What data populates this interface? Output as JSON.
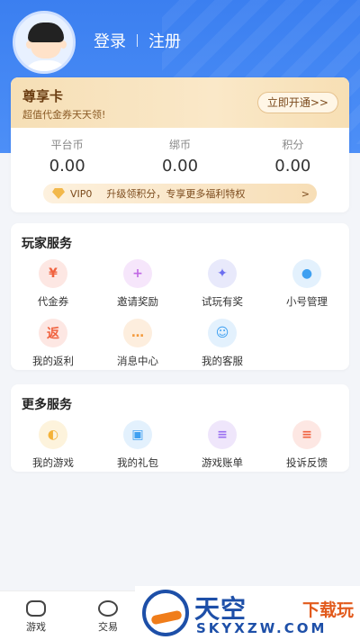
{
  "header": {
    "login": "登录",
    "register": "注册"
  },
  "vip": {
    "title": "尊享卡",
    "subtitle": "超值代金券天天领!",
    "button": "立即开通>>",
    "stats": [
      {
        "label": "平台币",
        "value": "0.00"
      },
      {
        "label": "绑币",
        "value": "0.00"
      },
      {
        "label": "积分",
        "value": "0.00"
      }
    ],
    "level": "VIP0",
    "level_tip": "升级领积分，专享更多福利特权",
    "arrow": ">"
  },
  "player_services": {
    "title": "玩家服务",
    "items": [
      {
        "label": "代金券",
        "icon": "voucher-icon",
        "char": "¥",
        "bg": "#fde7e3",
        "fg": "#f0623f"
      },
      {
        "label": "邀请奖励",
        "icon": "invite-icon",
        "char": "+",
        "bg": "#f6e6fb",
        "fg": "#c169e4"
      },
      {
        "label": "试玩有奖",
        "icon": "gamepad-icon",
        "char": "✦",
        "bg": "#e8e9fb",
        "fg": "#6c6ff0"
      },
      {
        "label": "小号管理",
        "icon": "account-icon",
        "char": "●",
        "bg": "#e3f1fd",
        "fg": "#3fa0f1"
      },
      {
        "label": "我的返利",
        "icon": "rebate-icon",
        "char": "返",
        "bg": "#fde7e3",
        "fg": "#f0623f"
      },
      {
        "label": "消息中心",
        "icon": "message-icon",
        "char": "…",
        "bg": "#fdeede",
        "fg": "#f39a3c"
      },
      {
        "label": "我的客服",
        "icon": "service-icon",
        "char": "☺",
        "bg": "#e3f1fd",
        "fg": "#3fa0f1"
      }
    ]
  },
  "more_services": {
    "title": "更多服务",
    "items": [
      {
        "label": "我的游戏",
        "icon": "game-icon",
        "char": "◐",
        "bg": "#fdf3dc",
        "fg": "#f4b237"
      },
      {
        "label": "我的礼包",
        "icon": "gift-icon",
        "char": "▣",
        "bg": "#e3f1fd",
        "fg": "#3fa0f1"
      },
      {
        "label": "游戏账单",
        "icon": "bill-icon",
        "char": "≡",
        "bg": "#efe6fb",
        "fg": "#9a6ff0"
      },
      {
        "label": "投诉反馈",
        "icon": "feedback-icon",
        "char": "≡",
        "bg": "#fde7e3",
        "fg": "#f0623f"
      }
    ]
  },
  "tabbar": {
    "games": "游戏",
    "trade": "交易"
  },
  "watermark": {
    "brand": "天空",
    "suffix": "下载玩",
    "url": "SKYXZW.COM"
  }
}
